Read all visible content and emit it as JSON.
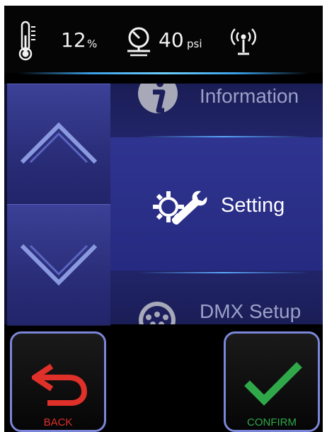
{
  "status": {
    "temperature_icon": "thermometer-icon",
    "humidity_value": "12",
    "humidity_unit": "%",
    "pressure_icon": "pressure-gauge-icon",
    "pressure_value": "40",
    "pressure_unit": "psi",
    "signal_icon": "wireless-antenna-icon"
  },
  "menu": {
    "up_icon": "chevron-up-icon",
    "down_icon": "chevron-down-icon",
    "items": [
      {
        "label": "Information",
        "icon": "info-icon"
      },
      {
        "label": "Setting",
        "icon": "gear-wrench-icon",
        "selected": true
      },
      {
        "label": "DMX Setup",
        "icon": "dmx-connector-icon"
      }
    ]
  },
  "buttons": {
    "back_label": "BACK",
    "back_icon": "undo-arrow-icon",
    "confirm_label": "CONFIRM",
    "confirm_icon": "checkmark-icon"
  },
  "colors": {
    "accent_blue": "#3aa0e8",
    "back_red": "#e0302a",
    "confirm_green": "#2fa84a",
    "panel_blue": "#2a2e80"
  }
}
